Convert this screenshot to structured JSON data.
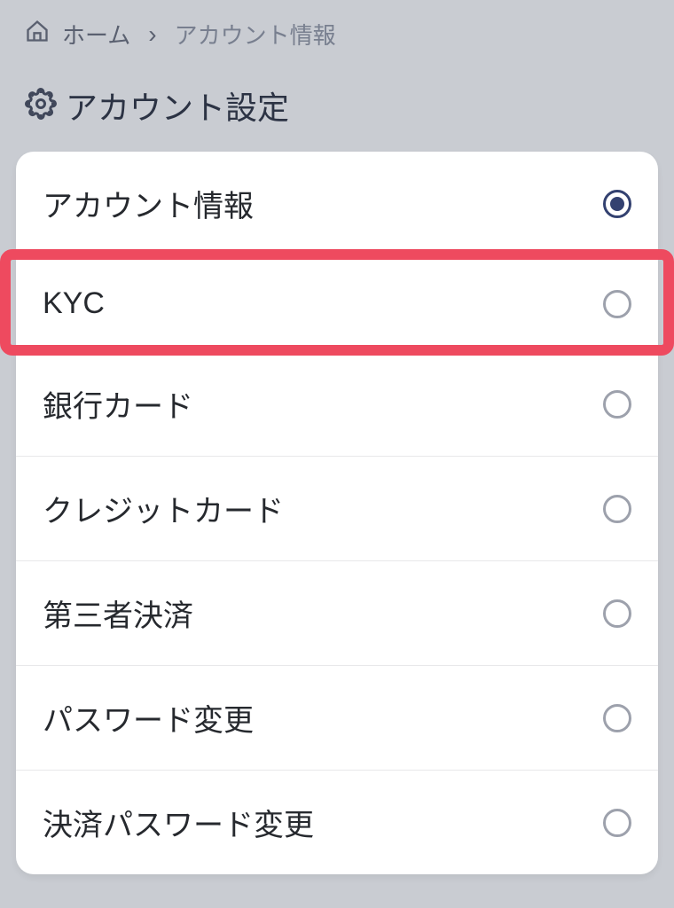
{
  "breadcrumb": {
    "home_label": "ホーム",
    "current_label": "アカウント情報"
  },
  "page_title": "アカウント設定",
  "options": [
    {
      "label": "アカウント情報",
      "selected": true
    },
    {
      "label": "KYC",
      "selected": false
    },
    {
      "label": "銀行カード",
      "selected": false
    },
    {
      "label": "クレジットカード",
      "selected": false
    },
    {
      "label": "第三者決済",
      "selected": false
    },
    {
      "label": "パスワード変更",
      "selected": false
    },
    {
      "label": "決済パスワード変更",
      "selected": false
    }
  ]
}
